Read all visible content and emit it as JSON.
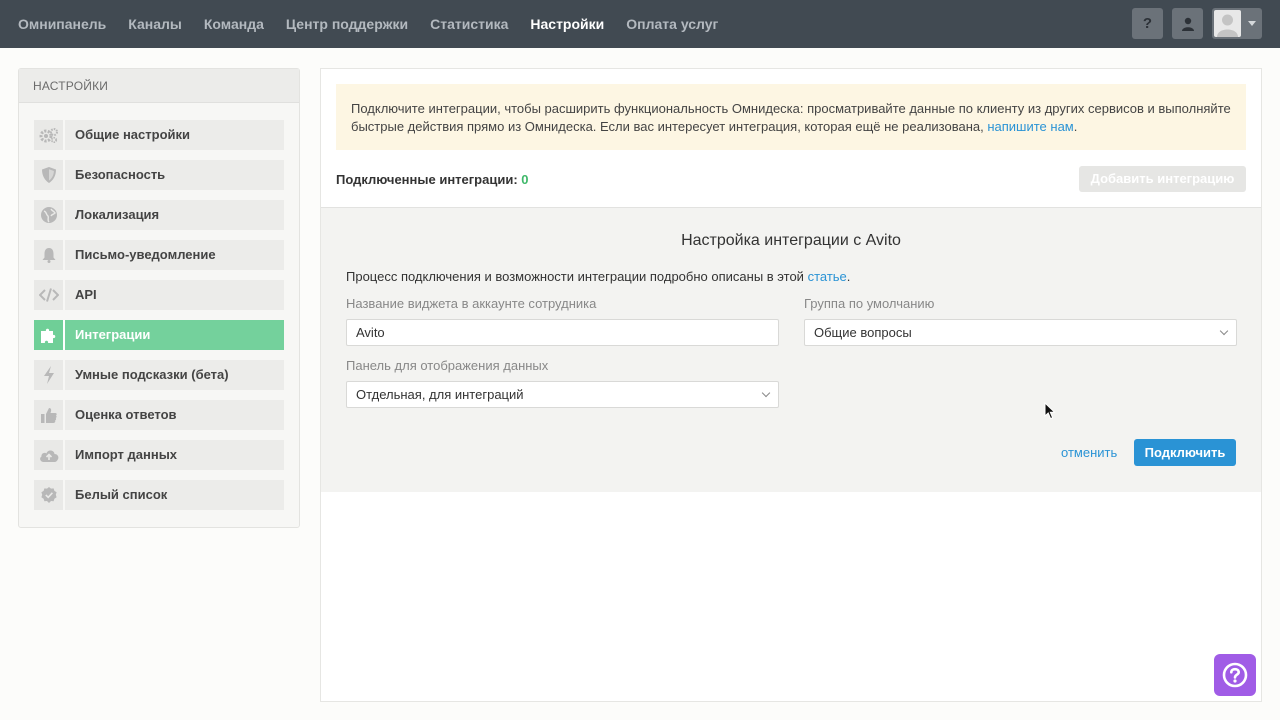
{
  "nav": {
    "items": [
      {
        "label": "Омнипанель",
        "active": false
      },
      {
        "label": "Каналы",
        "active": false
      },
      {
        "label": "Команда",
        "active": false
      },
      {
        "label": "Центр поддержки",
        "active": false
      },
      {
        "label": "Статистика",
        "active": false
      },
      {
        "label": "Настройки",
        "active": true
      },
      {
        "label": "Оплата услуг",
        "active": false
      }
    ],
    "help_label": "?"
  },
  "sidebar": {
    "title": "Настройки",
    "items": [
      {
        "label": "Общие настройки",
        "icon": "gears-icon"
      },
      {
        "label": "Безопасность",
        "icon": "shield-icon"
      },
      {
        "label": "Локализация",
        "icon": "globe-icon"
      },
      {
        "label": "Письмо-уведомление",
        "icon": "bell-icon"
      },
      {
        "label": "API",
        "icon": "code-icon"
      },
      {
        "label": "Интеграции",
        "icon": "puzzle-icon",
        "active": true
      },
      {
        "label": "Умные подсказки (бета)",
        "icon": "lightning-icon"
      },
      {
        "label": "Оценка ответов",
        "icon": "thumbs-up-icon"
      },
      {
        "label": "Импорт данных",
        "icon": "cloud-upload-icon"
      },
      {
        "label": "Белый список",
        "icon": "check-badge-icon"
      }
    ]
  },
  "notice": {
    "text": "Подключите интеграции, чтобы расширить функциональность Омнидеска: просматривайте данные по клиенту из других сервисов и выполняйте быстрые действия прямо из Омнидеска. Если вас интересует интеграция, которая ещё не реализована, ",
    "link": "напишите нам",
    "end": "."
  },
  "integrations": {
    "connected_label": "Подключенные интеграции:",
    "connected_count": "0",
    "add_button": "Добавить интеграцию"
  },
  "form": {
    "title": "Настройка интеграции с Avito",
    "desc": "Процесс подключения и возможности интеграции подробно описаны в этой ",
    "desc_link": "статье",
    "desc_end": ".",
    "widget_name_label": "Название виджета в аккаунте сотрудника",
    "widget_name_value": "Avito",
    "group_label": "Группа по умолчанию",
    "group_value": "Общие вопросы",
    "panel_label": "Панель для отображения данных",
    "panel_value": "Отдельная, для интеграций",
    "cancel": "отменить",
    "connect": "Подключить"
  },
  "colors": {
    "topbar": "#414a52",
    "accent_green": "#74d19c",
    "link_blue": "#2a93d5",
    "help_purple": "#a05ce6"
  }
}
